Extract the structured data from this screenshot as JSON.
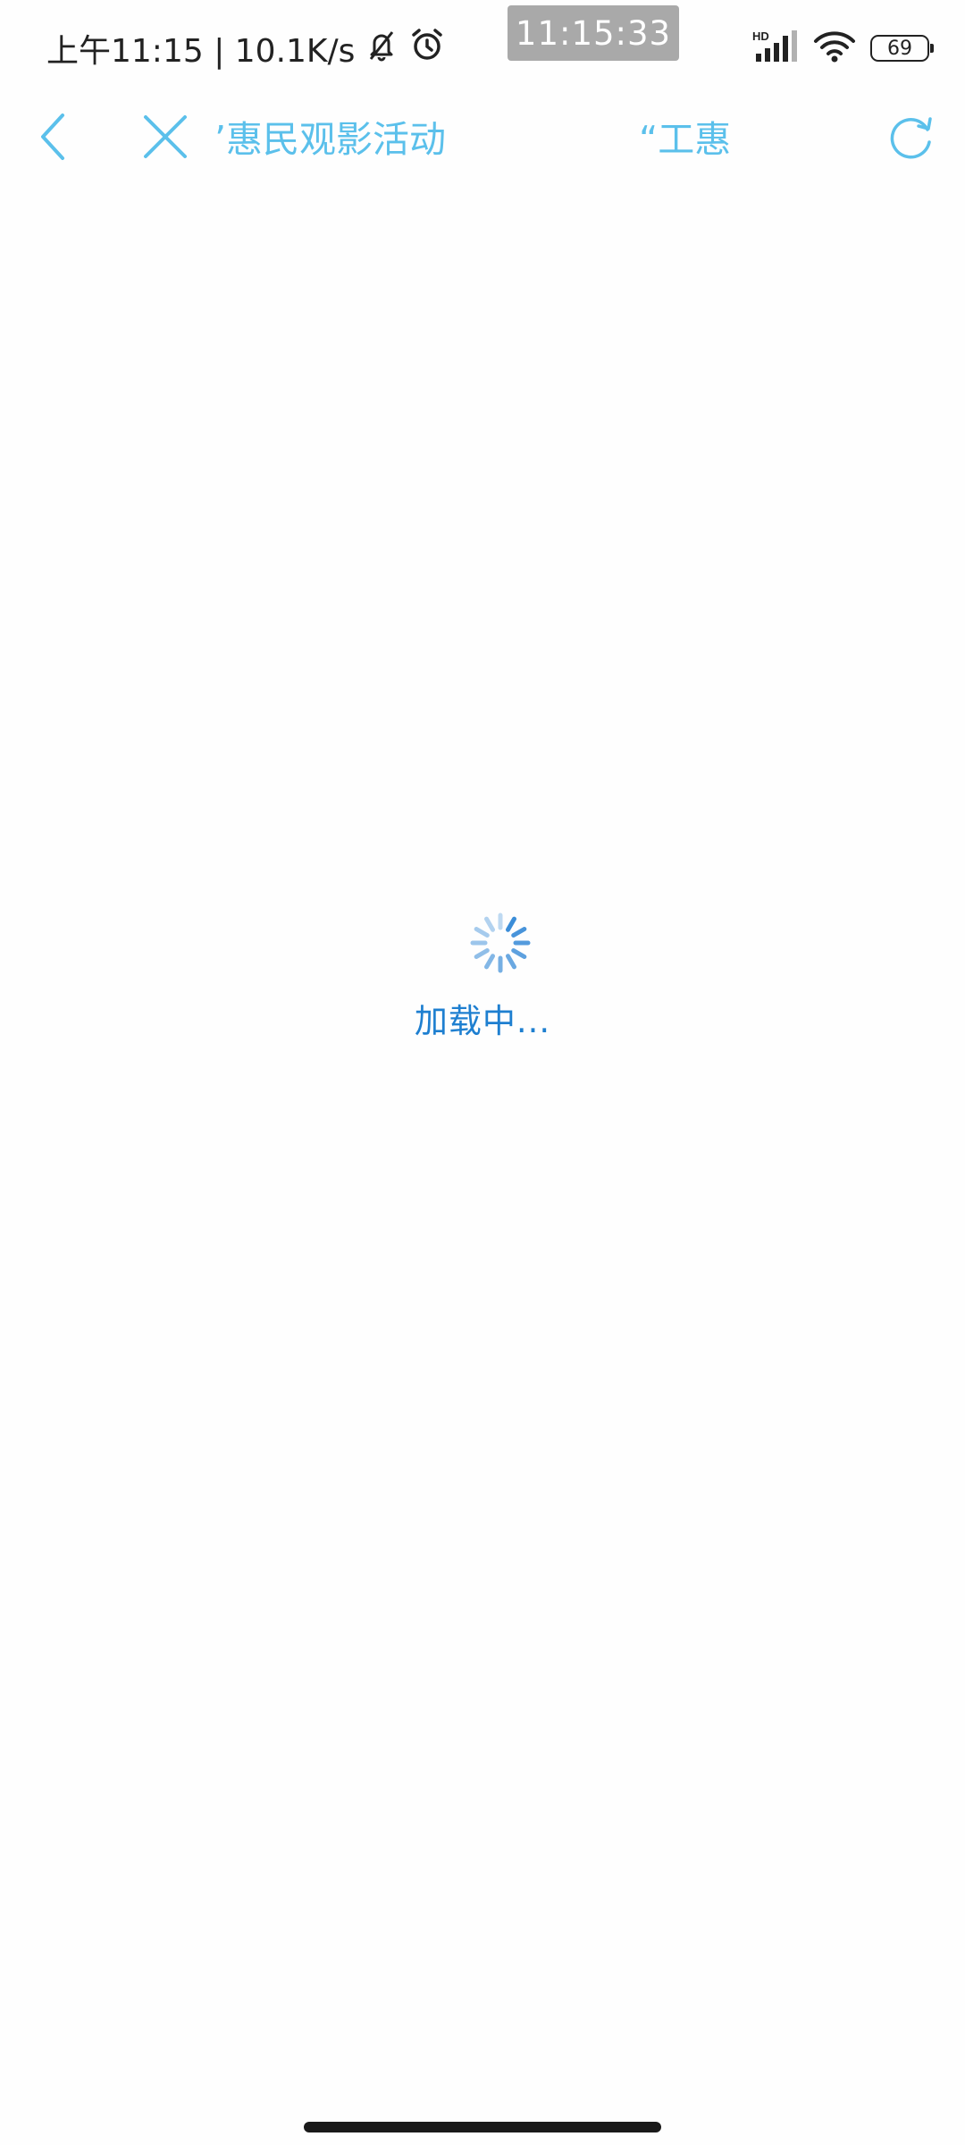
{
  "status_bar": {
    "time_net": "上午11:15 | 10.1K/s",
    "clock_overlay": "11:15:33",
    "network_type": "HD",
    "battery_level": "69"
  },
  "nav": {
    "title_part1": "’惠民观影活动",
    "title_part2": "“工惠",
    "accent_color": "#5bc0eb"
  },
  "loading": {
    "text": "加载中..."
  },
  "icons": {
    "back": "chevron-left-icon",
    "close": "close-icon",
    "refresh": "refresh-icon",
    "mute": "bell-off-icon",
    "alarm": "alarm-icon",
    "signal": "signal-icon",
    "wifi": "wifi-icon"
  }
}
